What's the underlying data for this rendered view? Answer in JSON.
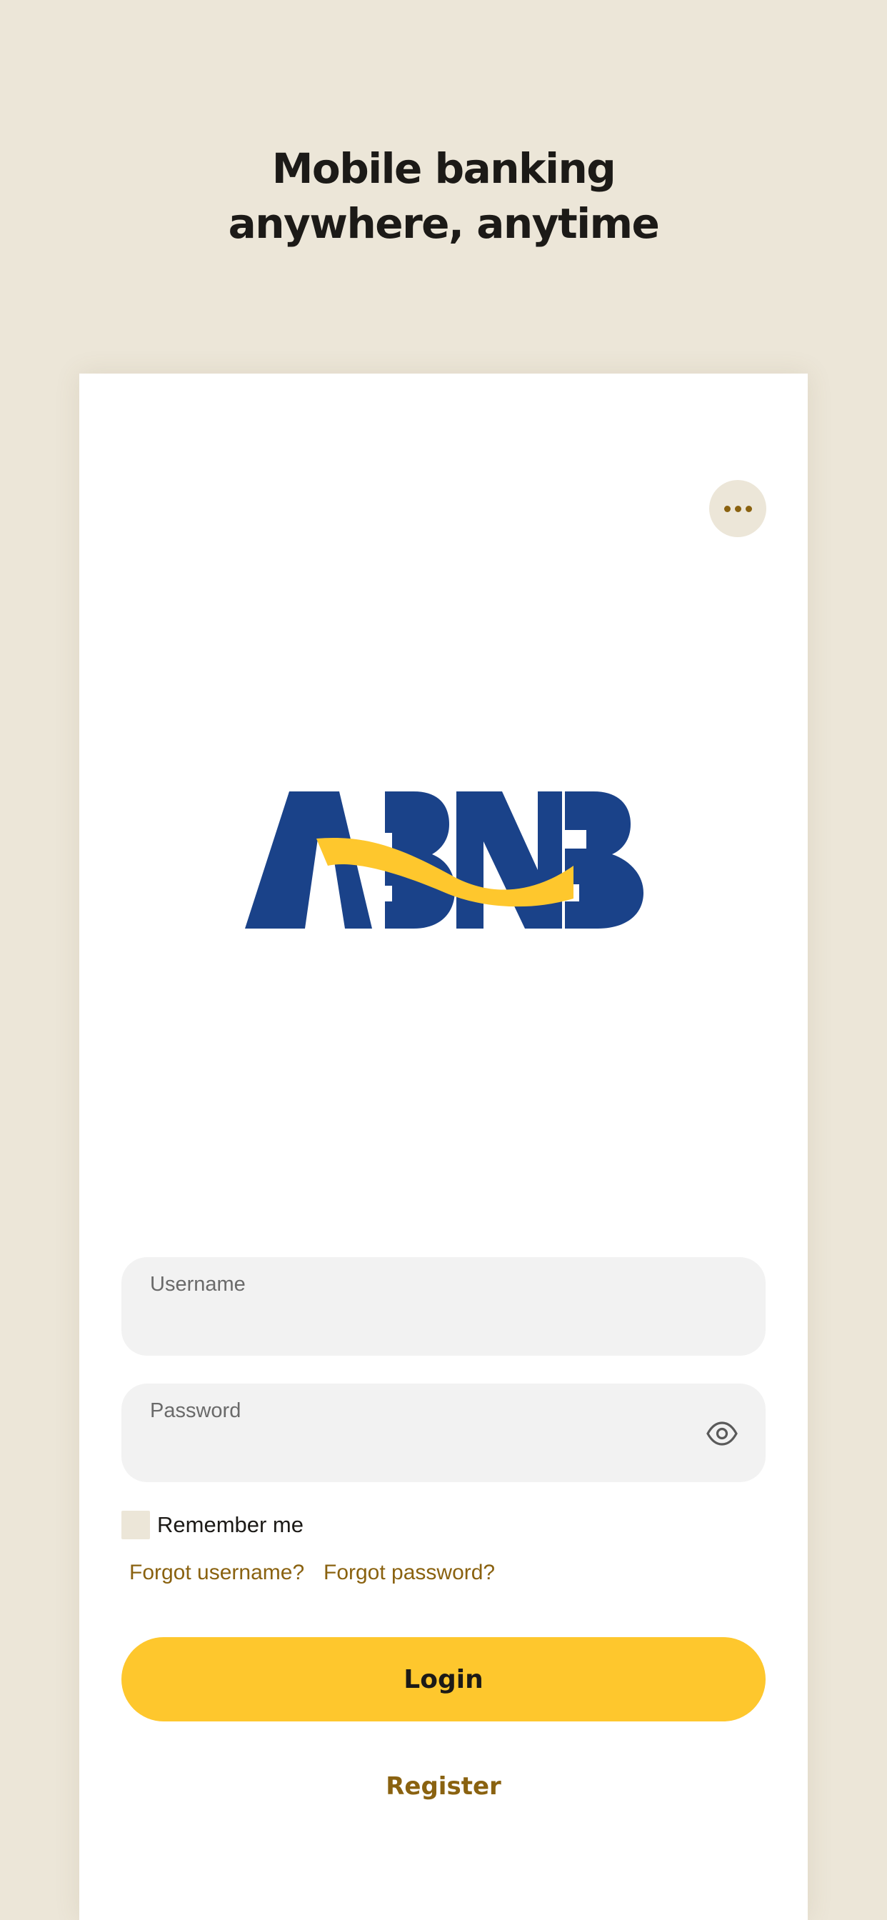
{
  "headline": {
    "line1": "Mobile banking",
    "line2": "anywhere, anytime"
  },
  "menu": {
    "icon": "more-horizontal-icon"
  },
  "logo": {
    "text": "ABNB",
    "primary_color": "#1A4289",
    "accent_color": "#FEC72D"
  },
  "form": {
    "username": {
      "label": "Username",
      "value": ""
    },
    "password": {
      "label": "Password",
      "value": "",
      "toggle_icon": "eye-icon"
    },
    "remember_me": {
      "label": "Remember me",
      "checked": false
    },
    "forgot_username": "Forgot username?",
    "forgot_password": "Forgot password?",
    "login_label": "Login",
    "register_label": "Register"
  },
  "colors": {
    "background": "#ECE6D8",
    "card": "#FFFFFF",
    "accent": "#FEC72D",
    "link": "#8A6210",
    "field": "#F2F2F2"
  }
}
